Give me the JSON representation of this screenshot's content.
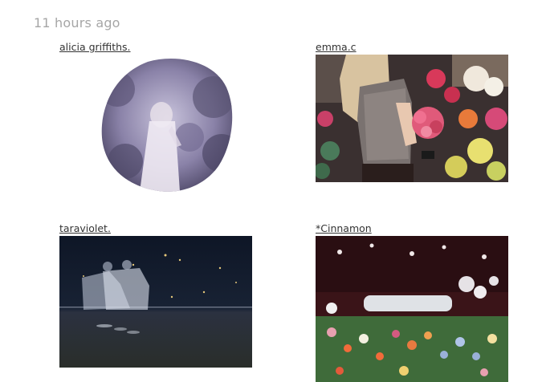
{
  "feed": {
    "timestamp": "11 hours ago",
    "posts": [
      {
        "username": "alicia griffiths.",
        "image": "girl-in-white-dress-blob-crop"
      },
      {
        "username": "emma.c",
        "image": "girl-holding-roses-flower-market"
      },
      {
        "username": "taraviolet.",
        "image": "blurred-dancers-night-stage"
      },
      {
        "username": "*Cinnamon",
        "image": "wildflower-garden-dark"
      }
    ]
  },
  "colors": {
    "timestamp": "#a6a6a6",
    "link": "#333333"
  }
}
